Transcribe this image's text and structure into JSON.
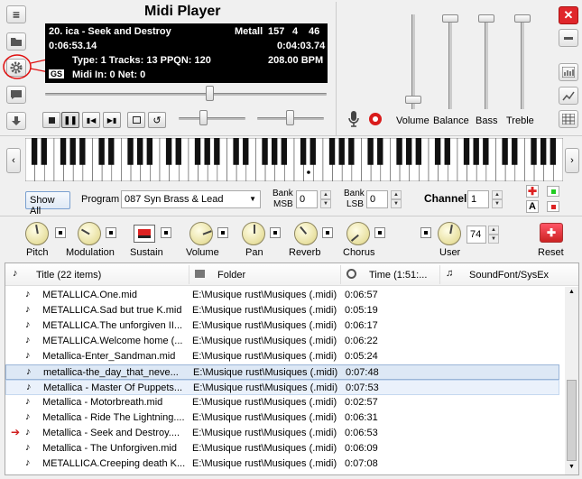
{
  "app": {
    "title": "Midi Player"
  },
  "display": {
    "song": "20. ica - Seek and Destroy",
    "artist": "Metall",
    "n1": "157",
    "n2": "4",
    "n3": "46",
    "elapsed": "0:06:53.14",
    "total": "0:04:03.74",
    "type_info": "Type: 1 Tracks: 13 PPQN: 120",
    "bpm": "208.00 BPM",
    "gs": "GS",
    "midi_info": "Midi In: 0  Net: 0"
  },
  "sliders": {
    "volume": "Volume",
    "balance": "Balance",
    "bass": "Bass",
    "treble": "Treble"
  },
  "controls": {
    "show_all": "Show All",
    "program_label": "Program",
    "program_value": "087 Syn Brass & Lead",
    "bank_msb_label1": "Bank",
    "bank_msb_label2": "MSB",
    "bank_msb_value": "0",
    "bank_lsb_label1": "Bank",
    "bank_lsb_label2": "LSB",
    "bank_lsb_value": "0",
    "channel_label": "Channel",
    "channel_value": "1",
    "a_label": "A"
  },
  "knobs": {
    "pitch": "Pitch",
    "modulation": "Modulation",
    "sustain": "Sustain",
    "volume": "Volume",
    "pan": "Pan",
    "reverb": "Reverb",
    "chorus": "Chorus",
    "user": "User",
    "user_value": "74",
    "reset": "Reset"
  },
  "table": {
    "headers": {
      "title": "Title (22 items)",
      "folder": "Folder",
      "time": "Time (1:51:...",
      "soundfont": "SoundFont/SysEx"
    },
    "rows": [
      {
        "title": "METALLICA.One.mid",
        "folder": "E:\\Musique rust\\Musiques (.midi)",
        "time": "0:06:57"
      },
      {
        "title": "METALLICA.Sad but true K.mid",
        "folder": "E:\\Musique rust\\Musiques (.midi)",
        "time": "0:05:19"
      },
      {
        "title": "METALLICA.The unforgiven II...",
        "folder": "E:\\Musique rust\\Musiques (.midi)",
        "time": "0:06:17"
      },
      {
        "title": "METALLICA.Welcome home (...",
        "folder": "E:\\Musique rust\\Musiques (.midi)",
        "time": "0:06:22"
      },
      {
        "title": "Metallica-Enter_Sandman.mid",
        "folder": "E:\\Musique rust\\Musiques (.midi)",
        "time": "0:05:24"
      },
      {
        "title": "metallica-the_day_that_neve...",
        "folder": "E:\\Musique rust\\Musiques (.midi)",
        "time": "0:07:48"
      },
      {
        "title": "Metallica - Master Of Puppets...",
        "folder": "E:\\Musique rust\\Musiques (.midi)",
        "time": "0:07:53"
      },
      {
        "title": "Metallica - Motorbreath.mid",
        "folder": "E:\\Musique rust\\Musiques (.midi)",
        "time": "0:02:57"
      },
      {
        "title": "Metallica - Ride The Lightning....",
        "folder": "E:\\Musique rust\\Musiques (.midi)",
        "time": "0:06:31"
      },
      {
        "title": "Metallica - Seek and Destroy....",
        "folder": "E:\\Musique rust\\Musiques (.midi)",
        "time": "0:06:53"
      },
      {
        "title": "Metallica - The Unforgiven.mid",
        "folder": "E:\\Musique rust\\Musiques (.midi)",
        "time": "0:06:09"
      },
      {
        "title": "METALLICA.Creeping death K...",
        "folder": "E:\\Musique rust\\Musiques (.midi)",
        "time": "0:07:08"
      }
    ]
  },
  "colors": {
    "close": "#e0262b",
    "lcd_bg": "#000000",
    "record": "#d91c1c",
    "playing_arrow": "#d02020",
    "selection": "#dde8f5"
  },
  "levels": {
    "position": 0.62,
    "tempo": 0.25,
    "pitch_bend": 0.4,
    "vol": 0.02,
    "bal": 0.0,
    "bass": 0.0,
    "treble": 0.0
  }
}
